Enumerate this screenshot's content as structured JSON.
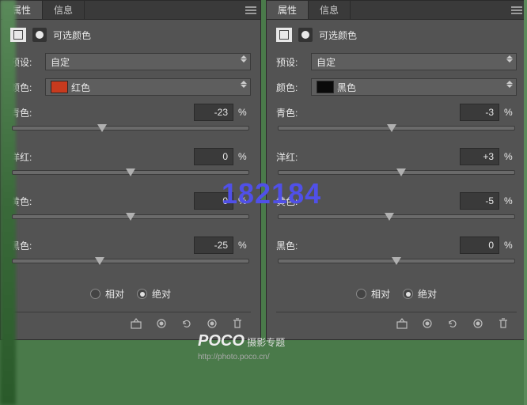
{
  "tabs": {
    "properties": "属性",
    "info": "信息"
  },
  "panel_title": "可选颜色",
  "preset": {
    "label": "预设:",
    "value": "自定"
  },
  "color_label": "颜色:",
  "sliders": {
    "cyan": {
      "label": "青色:",
      "unit": "%"
    },
    "magenta": {
      "label": "洋红:",
      "unit": "%"
    },
    "yellow": {
      "label": "黄色:",
      "unit": "%"
    },
    "black": {
      "label": "黑色:",
      "unit": "%"
    }
  },
  "method": {
    "relative": "相对",
    "absolute": "绝对"
  },
  "panels": [
    {
      "color_name": "红色",
      "swatch": "#c83a1e",
      "values": {
        "cyan": "-23",
        "magenta": "0",
        "yellow": "0",
        "black": "-25"
      },
      "positions": {
        "cyan": 38,
        "magenta": 50,
        "yellow": 50,
        "black": 37
      },
      "method_selected": "absolute"
    },
    {
      "color_name": "黑色",
      "swatch": "#0a0a0a",
      "values": {
        "cyan": "-3",
        "magenta": "+3",
        "yellow": "-5",
        "black": "0"
      },
      "positions": {
        "cyan": 48,
        "magenta": 52,
        "yellow": 47,
        "black": 50
      },
      "method_selected": "absolute"
    }
  ],
  "watermark_number": "182184",
  "watermark_logo": {
    "brand": "POCO",
    "text": "摄影专题",
    "url": "http://photo.poco.cn/"
  }
}
